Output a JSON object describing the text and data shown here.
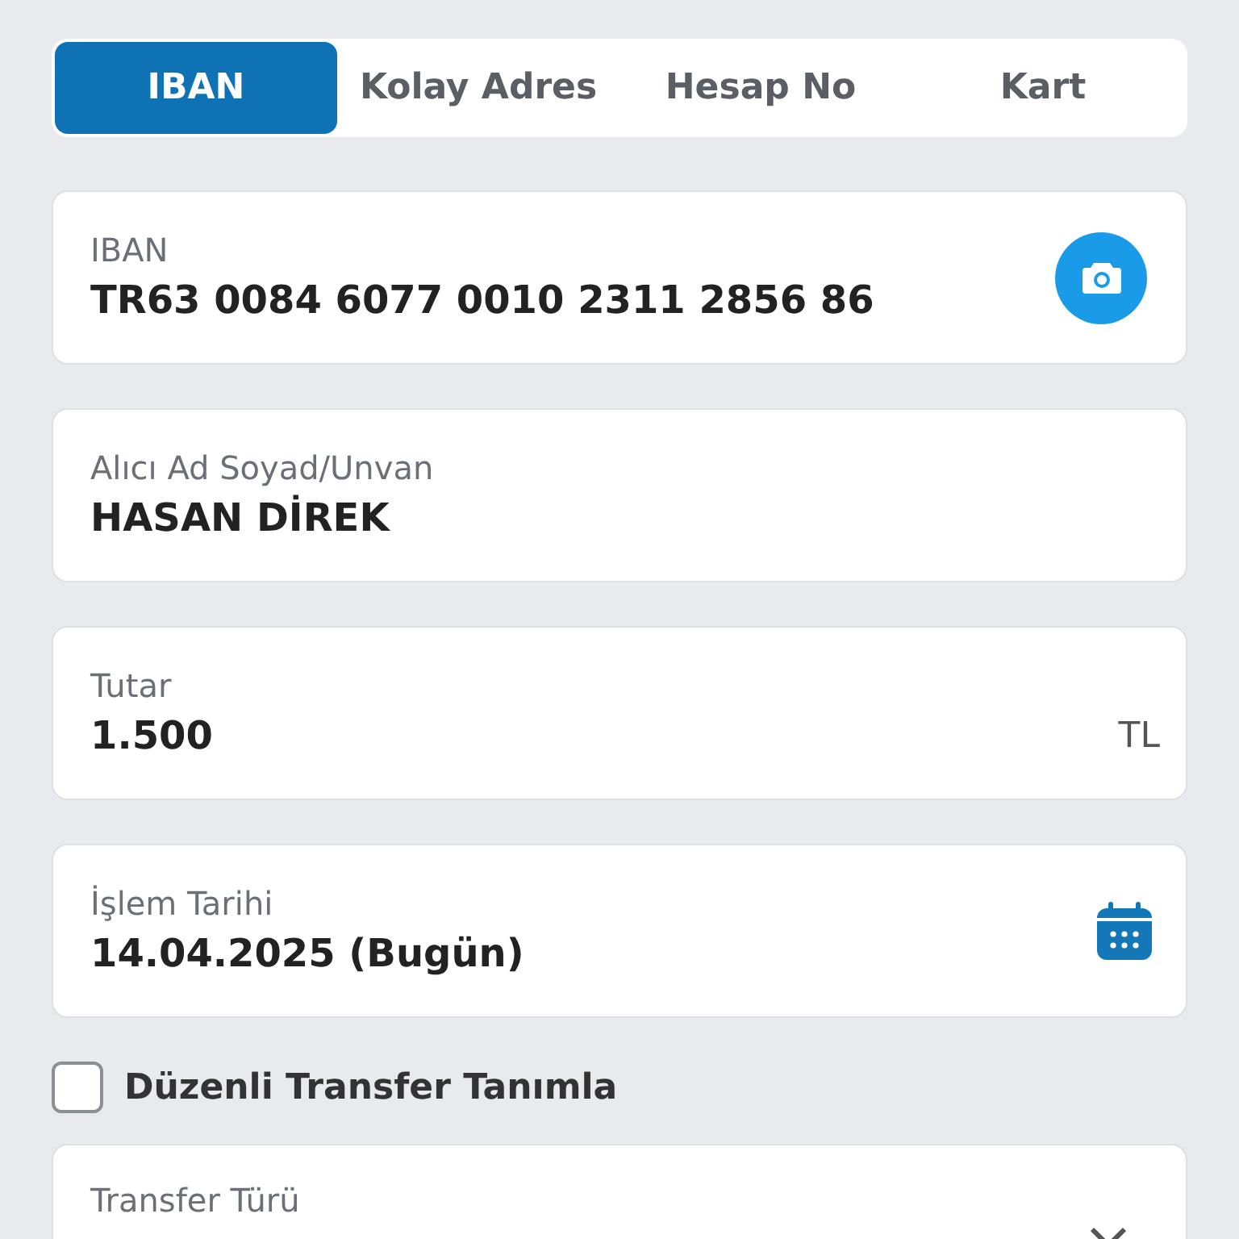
{
  "tabs": [
    {
      "label": "IBAN",
      "selected": true
    },
    {
      "label": "Kolay Adres",
      "selected": false
    },
    {
      "label": "Hesap No",
      "selected": false
    },
    {
      "label": "Kart",
      "selected": false
    }
  ],
  "fields": [
    {
      "label": "IBAN",
      "value": "TR63 0084 6077 0010 2311 2856 86",
      "kind": "camera"
    },
    {
      "label": "Alıcı Ad Soyad/Unvan",
      "value": "HASAN DİREK",
      "kind": "plain"
    },
    {
      "label": "Tutar",
      "value": "1.500",
      "kind": "suffix",
      "suffix": "TL"
    },
    {
      "label": "İşlem Tarihi",
      "value": "14.04.2025 (Bugün)",
      "kind": "calendar"
    }
  ],
  "recurring": {
    "label": "Düzenli Transfer Tanımla",
    "checked": false
  },
  "transfer_type": {
    "label": "Transfer Türü",
    "kind": "select"
  }
}
